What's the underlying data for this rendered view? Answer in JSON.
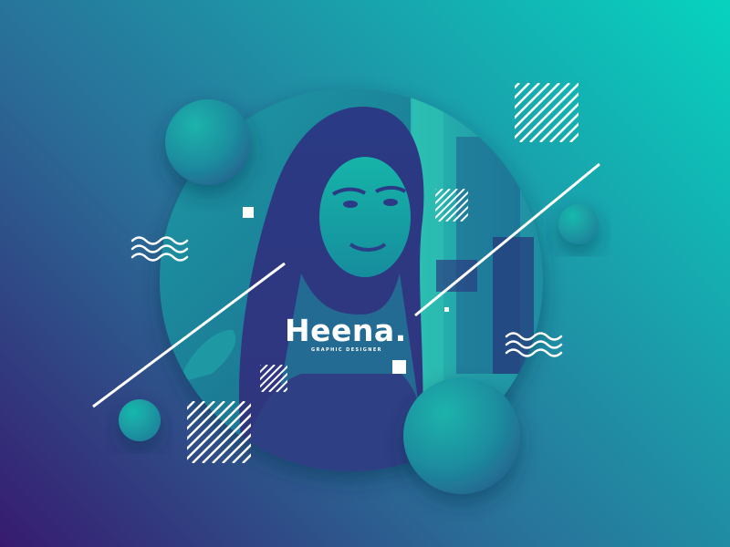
{
  "profile": {
    "name": "Heena.",
    "role": "GRAPHIC DESIGNER"
  },
  "colors": {
    "background_top_right": "#07d3bf",
    "background_bottom_left": "#371a6f",
    "accent": "#ffffff"
  },
  "icons": [
    "wave-icon",
    "hatched-square-icon",
    "filled-square-icon",
    "diagonal-line",
    "sphere"
  ]
}
